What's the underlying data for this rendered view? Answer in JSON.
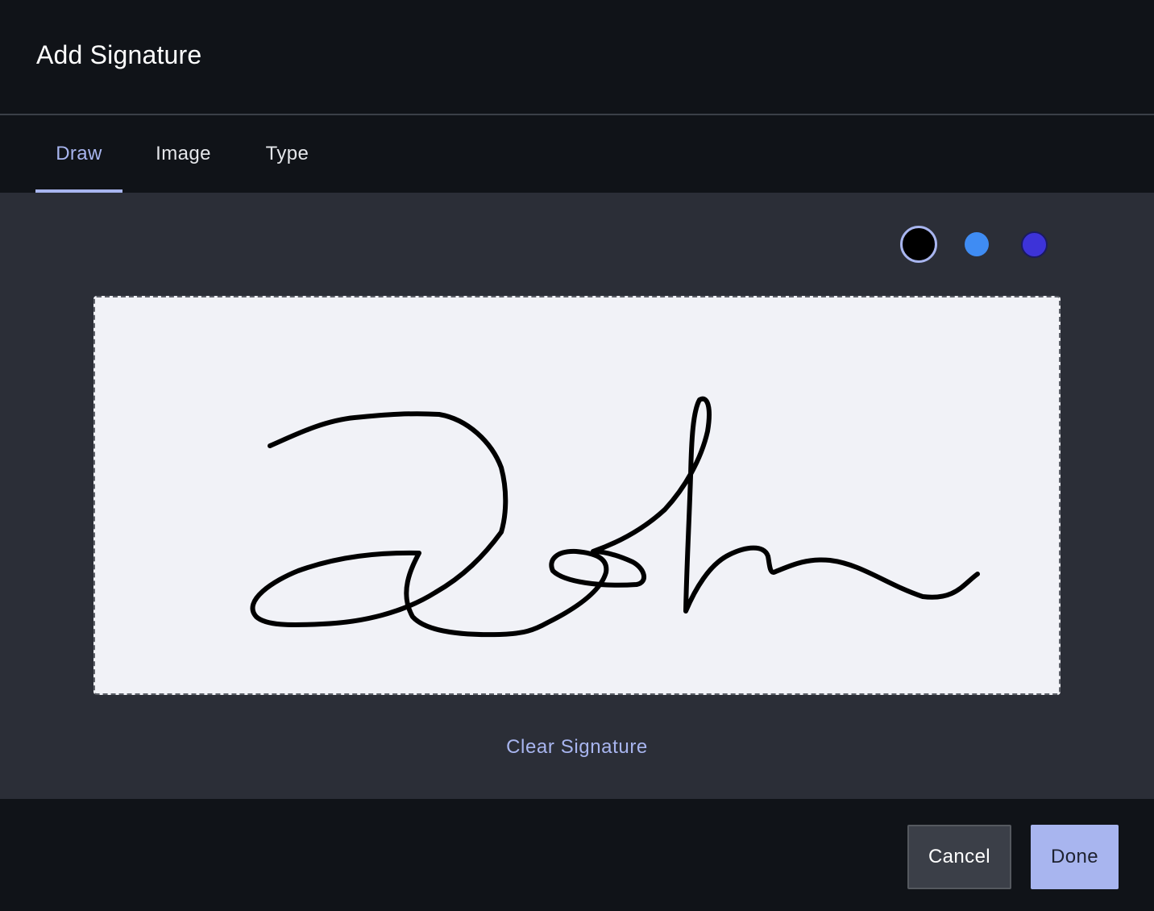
{
  "dialog": {
    "title": "Add Signature"
  },
  "tabs": [
    {
      "label": "Draw",
      "active": true
    },
    {
      "label": "Image",
      "active": false
    },
    {
      "label": "Type",
      "active": false
    }
  ],
  "colors": {
    "accent": "#a8b5ef",
    "swatches": [
      {
        "name": "black",
        "hex": "#000000",
        "selected": true
      },
      {
        "name": "blue",
        "hex": "#3f8cf3",
        "selected": false
      },
      {
        "name": "indigo",
        "hex": "#3d33d8",
        "selected": false
      }
    ]
  },
  "canvas": {
    "ink_color": "#000000"
  },
  "actions": {
    "clear_label": "Clear Signature",
    "cancel_label": "Cancel",
    "done_label": "Done"
  }
}
